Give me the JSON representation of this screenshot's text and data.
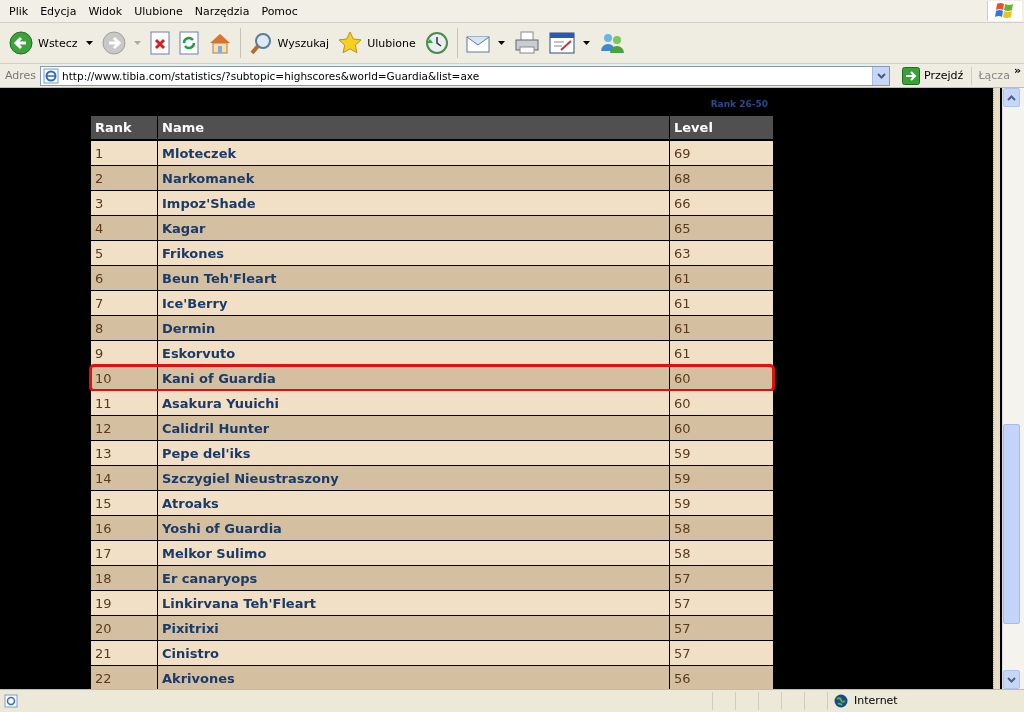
{
  "menu": [
    "Plik",
    "Edycja",
    "Widok",
    "Ulubione",
    "Narzędzia",
    "Pomoc"
  ],
  "toolbar": {
    "back": "Wstecz",
    "search": "Wyszukaj",
    "favorites": "Ulubione"
  },
  "address": {
    "label": "Adres",
    "url": "http://www.tibia.com/statistics/?subtopic=highscores&world=Guardia&list=axe",
    "go": "Przejdź",
    "links": "Łącza",
    "more": "»"
  },
  "page": {
    "pager_link": "Rank 26-50",
    "columns": [
      "Rank",
      "Name",
      "Level"
    ],
    "rows": [
      {
        "rank": "1",
        "name": "Mloteczek",
        "level": "69",
        "highlighted": false
      },
      {
        "rank": "2",
        "name": "Narkomanek",
        "level": "68",
        "highlighted": false
      },
      {
        "rank": "3",
        "name": "Impoz'Shade",
        "level": "66",
        "highlighted": false
      },
      {
        "rank": "4",
        "name": "Kagar",
        "level": "65",
        "highlighted": false
      },
      {
        "rank": "5",
        "name": "Frikones",
        "level": "63",
        "highlighted": false
      },
      {
        "rank": "6",
        "name": "Beun Teh'Fleart",
        "level": "61",
        "highlighted": false
      },
      {
        "rank": "7",
        "name": "Ice'Berry",
        "level": "61",
        "highlighted": false
      },
      {
        "rank": "8",
        "name": "Dermin",
        "level": "61",
        "highlighted": false
      },
      {
        "rank": "9",
        "name": "Eskorvuto",
        "level": "61",
        "highlighted": false
      },
      {
        "rank": "10",
        "name": "Kani of Guardia",
        "level": "60",
        "highlighted": true
      },
      {
        "rank": "11",
        "name": "Asakura Yuuichi",
        "level": "60",
        "highlighted": false
      },
      {
        "rank": "12",
        "name": "Calidril Hunter",
        "level": "60",
        "highlighted": false
      },
      {
        "rank": "13",
        "name": "Pepe del'iks",
        "level": "59",
        "highlighted": false
      },
      {
        "rank": "14",
        "name": "Szczygiel Nieustraszony",
        "level": "59",
        "highlighted": false
      },
      {
        "rank": "15",
        "name": "Atroaks",
        "level": "59",
        "highlighted": false
      },
      {
        "rank": "16",
        "name": "Yoshi of Guardia",
        "level": "58",
        "highlighted": false
      },
      {
        "rank": "17",
        "name": "Melkor Sulimo",
        "level": "58",
        "highlighted": false
      },
      {
        "rank": "18",
        "name": "Er canaryops",
        "level": "57",
        "highlighted": false
      },
      {
        "rank": "19",
        "name": "Linkirvana Teh'Fleart",
        "level": "57",
        "highlighted": false
      },
      {
        "rank": "20",
        "name": "Pixitrixi",
        "level": "57",
        "highlighted": false
      },
      {
        "rank": "21",
        "name": "Cinistro",
        "level": "57",
        "highlighted": false
      },
      {
        "rank": "22",
        "name": "Akrivones",
        "level": "56",
        "highlighted": false
      }
    ]
  },
  "status_bar": {
    "zone": "Internet"
  }
}
